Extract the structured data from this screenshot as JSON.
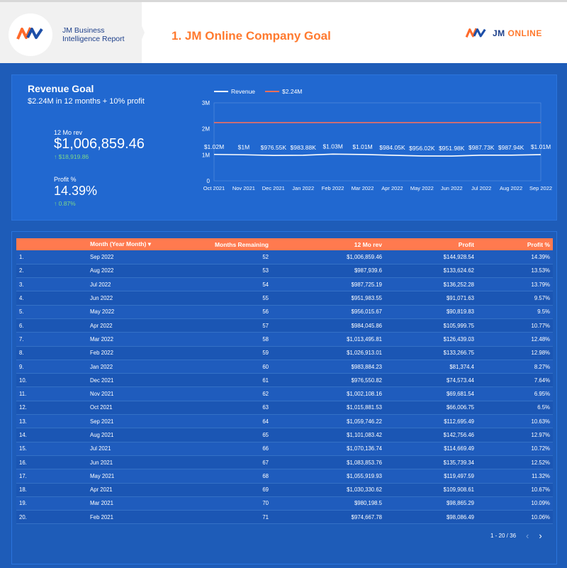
{
  "header": {
    "brand_line1": "JM Business",
    "brand_line2": "Intelligence Report",
    "title": "1. JM Online Company Goal",
    "right_logo_jm": "JM",
    "right_logo_online": "ONLINE"
  },
  "revenue_goal": {
    "title": "Revenue Goal",
    "subtitle": "$2.24M in 12 months + 10% profit",
    "kpi1_label": "12 Mo rev",
    "kpi1_value": "$1,006,859.46",
    "kpi1_delta": "↑ $18,919.86",
    "kpi2_label": "Profit %",
    "kpi2_value": "14.39%",
    "kpi2_delta": "↑ 0.87%"
  },
  "chart_data": {
    "type": "line",
    "categories": [
      "Oct 2021",
      "Nov 2021",
      "Dec 2021",
      "Jan 2022",
      "Feb 2022",
      "Mar 2022",
      "Apr 2022",
      "May 2022",
      "Jun 2022",
      "Jul 2022",
      "Aug 2022",
      "Sep 2022"
    ],
    "series": [
      {
        "name": "Revenue",
        "values": [
          1015881.53,
          1002108.16,
          976550.82,
          983884.23,
          1026913.01,
          1013495.81,
          984045.86,
          956015.67,
          951983.55,
          987725.19,
          987939.6,
          1006859.46
        ],
        "color": "#ffffff"
      },
      {
        "name": "$2.24M",
        "values": [
          2240000,
          2240000,
          2240000,
          2240000,
          2240000,
          2240000,
          2240000,
          2240000,
          2240000,
          2240000,
          2240000,
          2240000
        ],
        "color": "#ff6f5a"
      }
    ],
    "data_labels": [
      "$1.02M",
      "$1M",
      "$976.55K",
      "$983.88K",
      "$1.03M",
      "$1.01M",
      "$984.05K",
      "$956.02K",
      "$951.98K",
      "$987.73K",
      "$987.94K",
      "$1.01M"
    ],
    "y_ticks": [
      "0",
      "1M",
      "2M",
      "3M"
    ],
    "ylim": [
      0,
      3000000
    ],
    "grid": false,
    "legend": "top-left"
  },
  "table": {
    "headers": [
      "",
      "Month (Year Month)",
      "Months Remaining",
      "12 Mo rev",
      "Profit",
      "Profit %"
    ],
    "sort_icon": "▾",
    "rows": [
      [
        "1.",
        "Sep 2022",
        "52",
        "$1,006,859.46",
        "$144,928.54",
        "14.39%"
      ],
      [
        "2.",
        "Aug 2022",
        "53",
        "$987,939.6",
        "$133,624.62",
        "13.53%"
      ],
      [
        "3.",
        "Jul 2022",
        "54",
        "$987,725.19",
        "$136,252.28",
        "13.79%"
      ],
      [
        "4.",
        "Jun 2022",
        "55",
        "$951,983.55",
        "$91,071.63",
        "9.57%"
      ],
      [
        "5.",
        "May 2022",
        "56",
        "$956,015.67",
        "$90,819.83",
        "9.5%"
      ],
      [
        "6.",
        "Apr 2022",
        "57",
        "$984,045.86",
        "$105,999.75",
        "10.77%"
      ],
      [
        "7.",
        "Mar 2022",
        "58",
        "$1,013,495.81",
        "$126,439.03",
        "12.48%"
      ],
      [
        "8.",
        "Feb 2022",
        "59",
        "$1,026,913.01",
        "$133,266.75",
        "12.98%"
      ],
      [
        "9.",
        "Jan 2022",
        "60",
        "$983,884.23",
        "$81,374.4",
        "8.27%"
      ],
      [
        "10.",
        "Dec 2021",
        "61",
        "$976,550.82",
        "$74,573.44",
        "7.64%"
      ],
      [
        "11.",
        "Nov 2021",
        "62",
        "$1,002,108.16",
        "$69,681.54",
        "6.95%"
      ],
      [
        "12.",
        "Oct 2021",
        "63",
        "$1,015,881.53",
        "$66,006.75",
        "6.5%"
      ],
      [
        "13.",
        "Sep 2021",
        "64",
        "$1,059,746.22",
        "$112,695.49",
        "10.63%"
      ],
      [
        "14.",
        "Aug 2021",
        "65",
        "$1,101,083.42",
        "$142,756.46",
        "12.97%"
      ],
      [
        "15.",
        "Jul 2021",
        "66",
        "$1,070,136.74",
        "$114,669.49",
        "10.72%"
      ],
      [
        "16.",
        "Jun 2021",
        "67",
        "$1,083,853.76",
        "$135,739.34",
        "12.52%"
      ],
      [
        "17.",
        "May 2021",
        "68",
        "$1,055,919.93",
        "$119,497.59",
        "11.32%"
      ],
      [
        "18.",
        "Apr 2021",
        "69",
        "$1,030,330.62",
        "$109,908.61",
        "10.67%"
      ],
      [
        "19.",
        "Mar 2021",
        "70",
        "$980,198.5",
        "$98,865.29",
        "10.09%"
      ],
      [
        "20.",
        "Feb 2021",
        "71",
        "$974,667.78",
        "$98,086.49",
        "10.06%"
      ]
    ]
  },
  "pager": {
    "text": "1 - 20 / 36",
    "prev_icon": "‹",
    "next_icon": "›"
  },
  "colors": {
    "accent_orange": "#ff7a2f",
    "background_blue": "#1e5cb8",
    "positive_green": "#7dd889"
  }
}
